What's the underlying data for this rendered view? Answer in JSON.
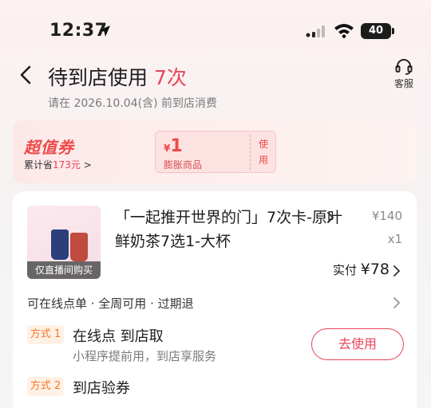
{
  "status_bar": {
    "time": "12:37",
    "battery": "40"
  },
  "header": {
    "title_prefix": "待到店使用",
    "title_count": "7次",
    "service_label": "客服",
    "deadline": "请在 2026.10.04(含) 前到店消费"
  },
  "banner": {
    "title": "超值券",
    "saved_prefix": "累计省",
    "saved_amount": "173元",
    "saved_suffix": ">",
    "coupon_currency": "¥",
    "coupon_value": "1",
    "coupon_desc": "膨胀商品",
    "coupon_action": "使用"
  },
  "order": {
    "thumb_tag": "仅直播间购买",
    "product_name": "「一起推开世界的门」7次卡-原叶鲜奶茶7选1-大杯",
    "price": "¥140",
    "quantity": "x1",
    "paid_label": "实付",
    "paid_amount": "¥78",
    "usage_info": "可在线点单 · 全周可用 · 过期退",
    "methods": [
      {
        "tag": "方式 1",
        "title": "在线点 到店取",
        "desc": "小程序提前用，到店享服务"
      },
      {
        "tag": "方式 2",
        "title": "到店验券"
      }
    ],
    "use_button": "去使用"
  },
  "colors": {
    "accent": "#e7455b",
    "orange": "#f07a28"
  }
}
